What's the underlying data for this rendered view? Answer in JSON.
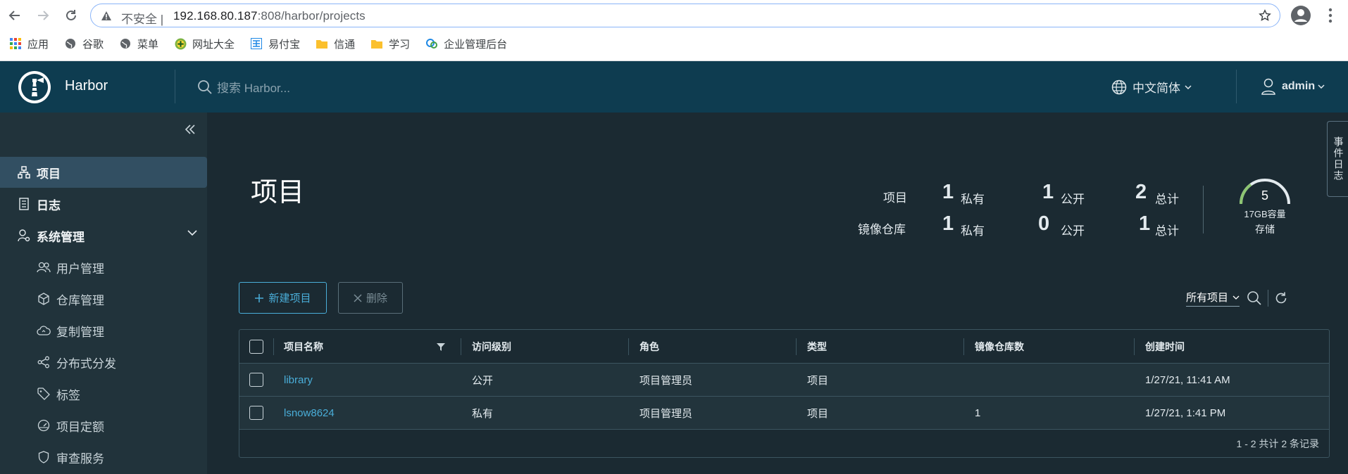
{
  "browser": {
    "insecure_label": "不安全",
    "url_host": "192.168.80.187",
    "url_rest": ":808/harbor/projects"
  },
  "bookmarks": [
    {
      "label": "应用",
      "icon": "apps-grid-icon"
    },
    {
      "label": "谷歌",
      "icon": "globe-icon"
    },
    {
      "label": "菜单",
      "icon": "globe-icon"
    },
    {
      "label": "网址大全",
      "icon": "plus-circle-icon"
    },
    {
      "label": "易付宝",
      "icon": "yifubao-icon"
    },
    {
      "label": "信通",
      "icon": "folder-icon"
    },
    {
      "label": "学习",
      "icon": "folder-icon"
    },
    {
      "label": "企业管理后台",
      "icon": "cloud-icon"
    }
  ],
  "header": {
    "brand": "Harbor",
    "search_placeholder": "搜索 Harbor...",
    "language": "中文简体",
    "user": "admin"
  },
  "sidebar": {
    "items": [
      {
        "label": "项目",
        "icon": "projects-icon"
      },
      {
        "label": "日志",
        "icon": "logs-icon"
      },
      {
        "label": "系统管理",
        "icon": "admin-icon"
      },
      {
        "label": "用户管理",
        "icon": "users-icon"
      },
      {
        "label": "仓库管理",
        "icon": "box-icon"
      },
      {
        "label": "复制管理",
        "icon": "cloud-icon"
      },
      {
        "label": "分布式分发",
        "icon": "share-icon"
      },
      {
        "label": "标签",
        "icon": "tag-icon"
      },
      {
        "label": "项目定额",
        "icon": "dashboard-icon"
      },
      {
        "label": "审查服务",
        "icon": "shield-icon"
      }
    ]
  },
  "page": {
    "title": "项目",
    "side_tab": "事件日志"
  },
  "stats": {
    "projects_label": "项目",
    "repos_label": "镜像仓库",
    "private_label": "私有",
    "public_label": "公开",
    "total_label": "总计",
    "projects": {
      "private": "1",
      "public": "1",
      "total": "2"
    },
    "repos": {
      "private": "1",
      "public": "0",
      "total": "1"
    },
    "storage": {
      "count": "5",
      "capacity": "17GB容量",
      "label": "存储",
      "used_fraction": 0.3
    }
  },
  "toolbar": {
    "new_project": "新建项目",
    "delete": "删除",
    "filter": "所有项目"
  },
  "table": {
    "columns": [
      "项目名称",
      "访问级别",
      "角色",
      "类型",
      "镜像仓库数",
      "创建时间"
    ],
    "rows": [
      {
        "name": "library",
        "access": "公开",
        "role": "项目管理员",
        "type": "项目",
        "repo_count": "",
        "created": "1/27/21, 11:41 AM"
      },
      {
        "name": "lsnow8624",
        "access": "私有",
        "role": "项目管理员",
        "type": "项目",
        "repo_count": "1",
        "created": "1/27/21, 1:41 PM"
      }
    ],
    "footer": "1 - 2 共计 2 条记录"
  }
}
